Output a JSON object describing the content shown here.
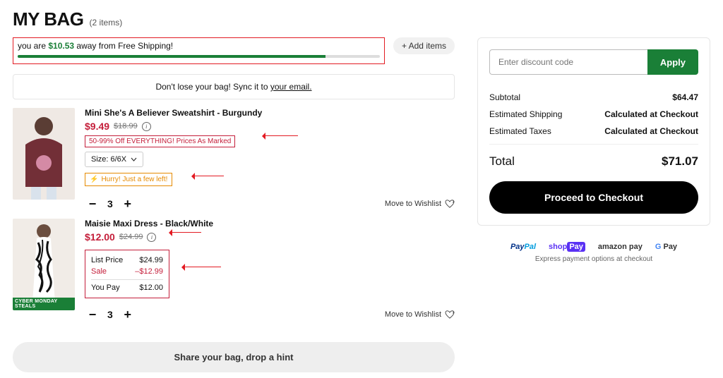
{
  "header": {
    "title": "MY BAG",
    "subtitle": "(2 items)"
  },
  "free_ship": {
    "pre": "you are ",
    "amount": "$10.53",
    "post": " away from Free Shipping!"
  },
  "add_items": "+ Add items",
  "sync_banner": {
    "pre": "Don't lose your bag! Sync it to ",
    "link": "your email."
  },
  "items": [
    {
      "name": "Mini She's A Believer Sweatshirt - Burgundy",
      "sale_price": "$9.49",
      "orig_price": "$18.99",
      "promo": "50-99% Off EVERYTHING! Prices As Marked",
      "size_label": "Size: 6/6X",
      "urgent": "Hurry! Just a few left!",
      "qty": "3",
      "wishlist": "Move to Wishlist"
    },
    {
      "name": "Maisie Maxi Dress - Black/White",
      "sale_price": "$12.00",
      "orig_price": "$24.99",
      "badge": "CYBER MONDAY STEALS",
      "breakdown": {
        "list_lbl": "List Price",
        "list_val": "$24.99",
        "sale_lbl": "Sale",
        "sale_val": "–$12.99",
        "you_lbl": "You Pay",
        "you_val": "$12.00"
      },
      "qty": "3",
      "wishlist": "Move to Wishlist"
    }
  ],
  "share_label": "Share your bag, drop a hint",
  "order": {
    "discount_ph": "Enter discount code",
    "apply": "Apply",
    "subtotal_lbl": "Subtotal",
    "subtotal_val": "$64.47",
    "ship_lbl": "Estimated Shipping",
    "ship_val": "Calculated at Checkout",
    "tax_lbl": "Estimated Taxes",
    "tax_val": "Calculated at Checkout",
    "total_lbl": "Total",
    "total_val": "$71.07",
    "checkout": "Proceed to Checkout",
    "express_note": "Express payment options at checkout",
    "paypal_p": "Pay",
    "paypal_pal": "Pal",
    "shop": "shop",
    "shop_pay": "Pay",
    "amazon": "amazon pay",
    "gpay": "G",
    "gpay2": " Pay"
  }
}
